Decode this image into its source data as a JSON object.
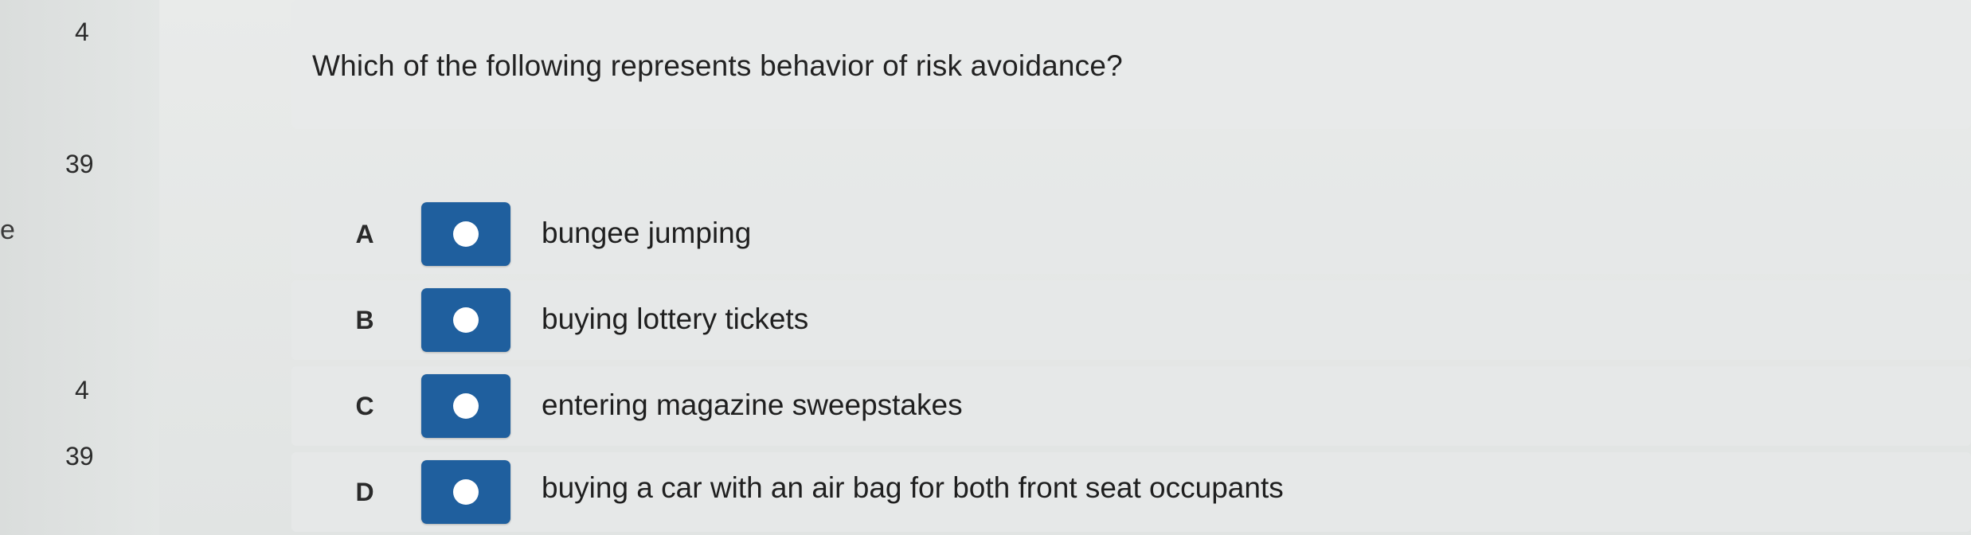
{
  "gutter": {
    "numbers": [
      "4",
      "39",
      "4",
      "39"
    ],
    "edge_letter": "e"
  },
  "question": {
    "text": "Which of the following represents behavior of risk avoidance?"
  },
  "options": [
    {
      "letter": "A",
      "text": "bungee jumping"
    },
    {
      "letter": "B",
      "text": "buying lottery tickets"
    },
    {
      "letter": "C",
      "text": "entering magazine sweepstakes"
    },
    {
      "letter": "D",
      "text": "buying a car with an air bag for both front seat occupants"
    }
  ],
  "colors": {
    "radio_button": "#1f5f9e",
    "radio_dot": "#ffffff",
    "background": "#e4e7e6"
  }
}
